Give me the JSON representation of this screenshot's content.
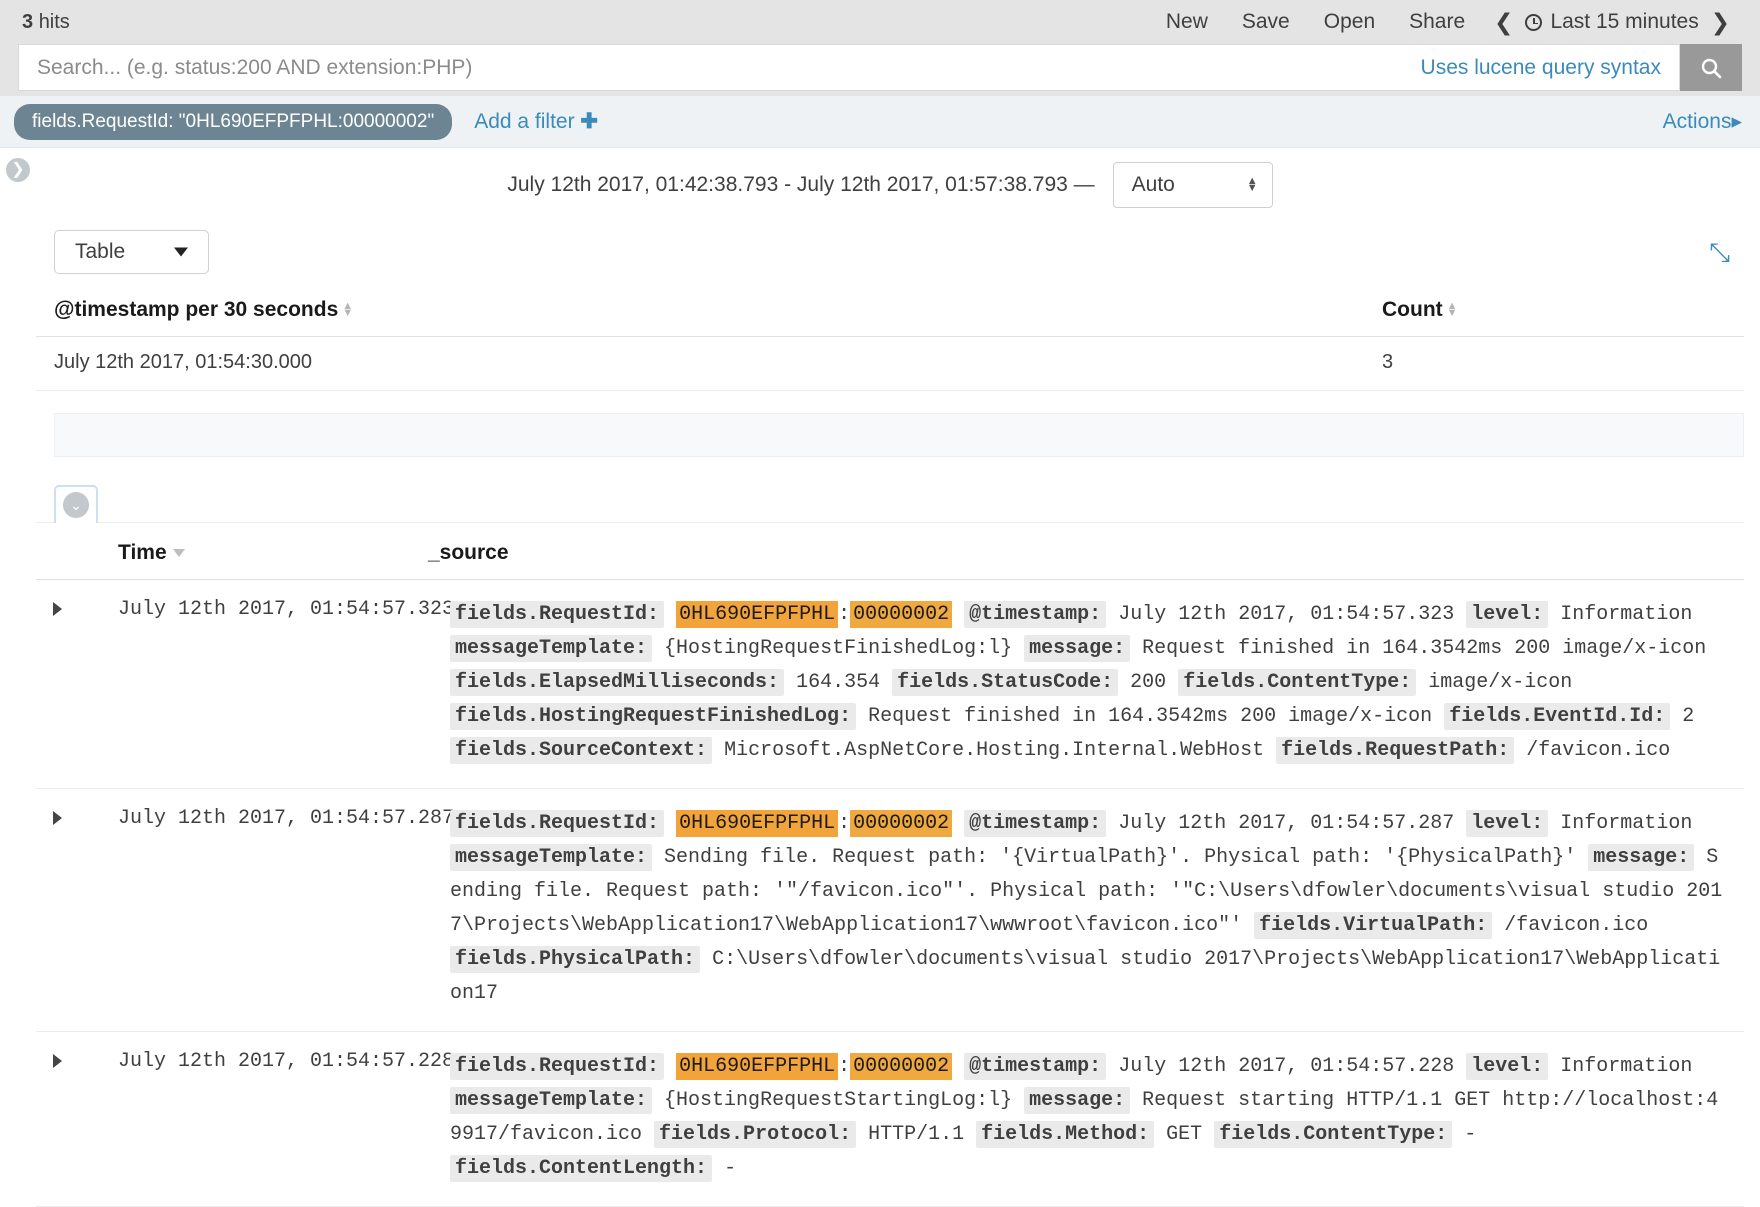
{
  "header": {
    "hits_count": "3",
    "hits_label": "hits",
    "nav": [
      {
        "label": "New",
        "name": "new-button"
      },
      {
        "label": "Save",
        "name": "save-button"
      },
      {
        "label": "Open",
        "name": "open-button"
      },
      {
        "label": "Share",
        "name": "share-button"
      }
    ],
    "prev_chevron": "❮",
    "next_chevron": "❯",
    "time_picker_label": "Last 15 minutes"
  },
  "search": {
    "value": "",
    "placeholder": "Search... (e.g. status:200 AND extension:PHP)",
    "lucene_hint": "Uses lucene query syntax",
    "search_icon": "search-icon"
  },
  "filters": {
    "pill_label": "fields.RequestId: \"0HL690EFPFPHL:00000002\"",
    "add_filter_label": "Add a filter",
    "add_filter_plus": "✚",
    "actions_label": "Actions",
    "actions_caret": "▸"
  },
  "sidebar": {
    "toggle_icon": "❯"
  },
  "timerange": {
    "text": "July 12th 2017, 01:42:38.793 - July 12th 2017, 01:57:38.793 —",
    "interval_value": "Auto",
    "interval_up": "▲",
    "interval_down": "▼"
  },
  "visualization": {
    "type_value": "Table",
    "expand_icon": "⤡"
  },
  "chart_data": {
    "type": "table",
    "title": "@timestamp per 30 seconds",
    "columns": [
      "@timestamp per 30 seconds",
      "Count"
    ],
    "categories": [
      "July 12th 2017, 01:54:30.000"
    ],
    "values": [
      3
    ],
    "rows": [
      {
        "timestamp": "July 12th 2017, 01:54:30.000",
        "count": "3"
      }
    ],
    "xlabel": "@timestamp per 30 seconds",
    "ylabel": "Count",
    "legend": "none",
    "grid": false
  },
  "docs": {
    "collapse_icon": "⌄",
    "columns": {
      "time": "Time",
      "source": "_source"
    },
    "rows": [
      {
        "time": "July 12th 2017, 01:54:57.323",
        "caret": "▶",
        "pairs": [
          {
            "field": "fields.RequestId:",
            "kind": "highlight",
            "hl1": "0HL690EFPFPHL",
            "sep": ":",
            "hl2": "00000002"
          },
          {
            "field": "@timestamp:",
            "value": "July 12th 2017, 01:54:57.323"
          },
          {
            "field": "level:",
            "value": "Information"
          },
          {
            "field": "messageTemplate:",
            "value": "{HostingRequestFinishedLog:l}"
          },
          {
            "field": "message:",
            "value": "Request finished in 164.3542ms 200 image/x-icon"
          },
          {
            "field": "fields.ElapsedMilliseconds:",
            "value": "164.354"
          },
          {
            "field": "fields.StatusCode:",
            "value": "200"
          },
          {
            "field": "fields.ContentType:",
            "value": "image/x-icon"
          },
          {
            "field": "fields.HostingRequestFinishedLog:",
            "value": "Request finished in 164.3542ms 200 image/x-icon"
          },
          {
            "field": "fields.EventId.Id:",
            "value": "2"
          },
          {
            "field": "fields.SourceContext:",
            "value": "Microsoft.AspNetCore.Hosting.Internal.WebHost"
          },
          {
            "field": "fields.RequestPath:",
            "value": "/favicon.ico"
          }
        ]
      },
      {
        "time": "July 12th 2017, 01:54:57.287",
        "caret": "▶",
        "pairs": [
          {
            "field": "fields.RequestId:",
            "kind": "highlight",
            "hl1": "0HL690EFPFPHL",
            "sep": ":",
            "hl2": "00000002"
          },
          {
            "field": "@timestamp:",
            "value": "July 12th 2017, 01:54:57.287"
          },
          {
            "field": "level:",
            "value": "Information"
          },
          {
            "field": "messageTemplate:",
            "value": "Sending file. Request path: '{VirtualPath}'. Physical path: '{PhysicalPath}'"
          },
          {
            "field": "message:",
            "value": "Sending file. Request path: '\"/favicon.ico\"'. Physical path: '\"C:\\Users\\dfowler\\documents\\visual studio 2017\\Projects\\WebApplication17\\WebApplication17\\wwwroot\\favicon.ico\"'"
          },
          {
            "field": "fields.VirtualPath:",
            "value": "/favicon.ico"
          },
          {
            "field": "fields.PhysicalPath:",
            "value": "C:\\Users\\dfowler\\documents\\visual studio 2017\\Projects\\WebApplication17\\WebApplication17"
          }
        ]
      },
      {
        "time": "July 12th 2017, 01:54:57.228",
        "caret": "▶",
        "pairs": [
          {
            "field": "fields.RequestId:",
            "kind": "highlight",
            "hl1": "0HL690EFPFPHL",
            "sep": ":",
            "hl2": "00000002"
          },
          {
            "field": "@timestamp:",
            "value": "July 12th 2017, 01:54:57.228"
          },
          {
            "field": "level:",
            "value": "Information"
          },
          {
            "field": "messageTemplate:",
            "value": "{HostingRequestStartingLog:l}"
          },
          {
            "field": "message:",
            "value": "Request starting HTTP/1.1 GET http://localhost:49917/favicon.ico"
          },
          {
            "field": "fields.Protocol:",
            "value": "HTTP/1.1"
          },
          {
            "field": "fields.Method:",
            "value": "GET"
          },
          {
            "field": "fields.ContentType:",
            "value": "-"
          },
          {
            "field": "fields.ContentLength:",
            "value": "-"
          }
        ]
      }
    ]
  }
}
